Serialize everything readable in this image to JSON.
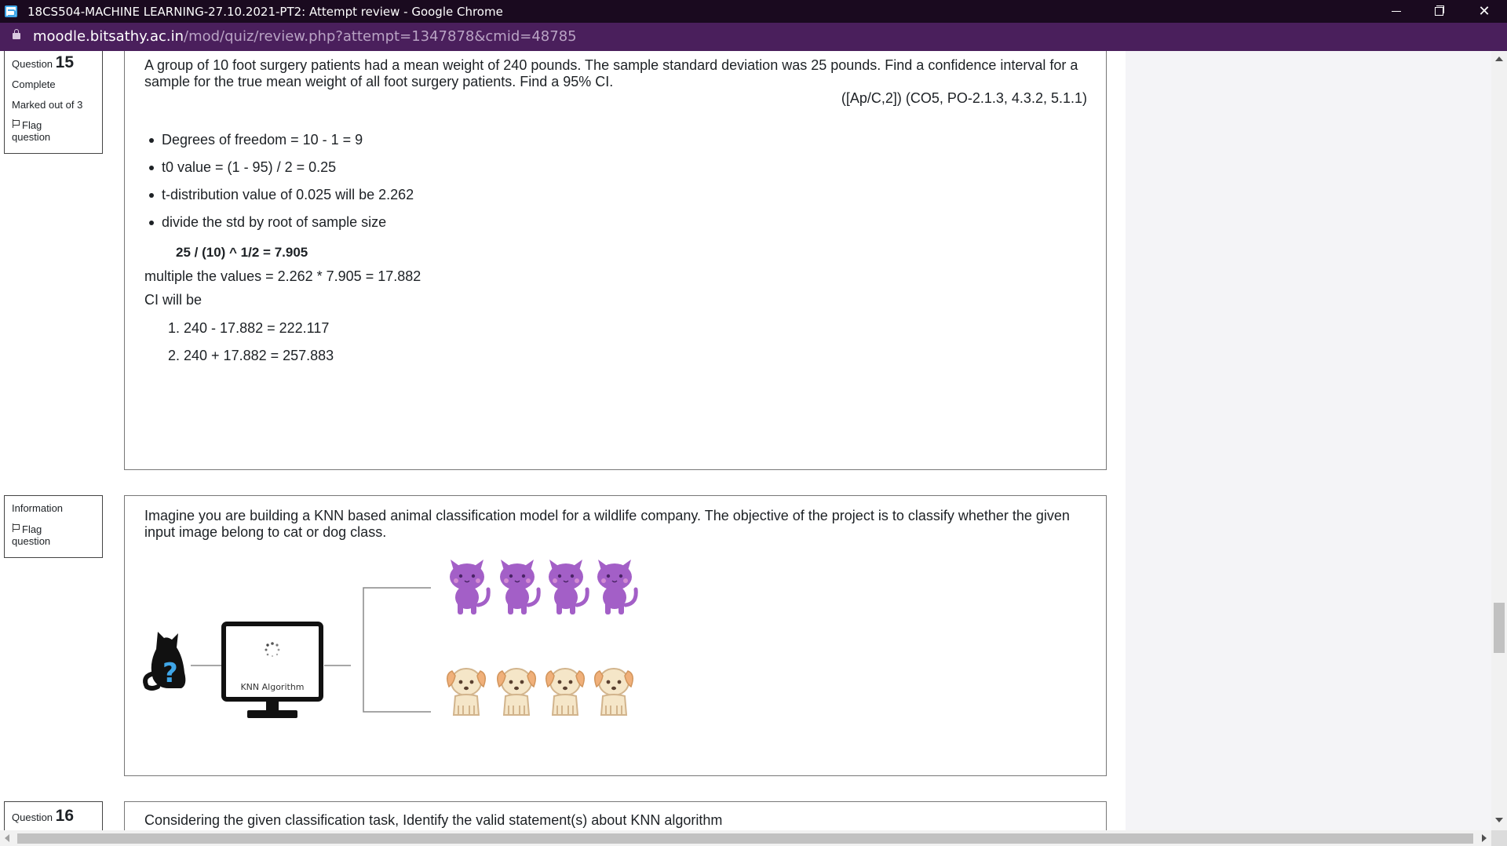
{
  "window": {
    "title": "18CS504-MACHINE LEARNING-27.10.2021-PT2: Attempt review - Google Chrome",
    "minimize_icon": "minimize-icon",
    "restore_icon": "restore-icon",
    "close_glyph": "✕"
  },
  "address_bar": {
    "host": "moodle.bitsathy.ac.in",
    "path": "/mod/quiz/review.php?attempt=1347878&cmid=48785"
  },
  "question15": {
    "label": "Question",
    "number": "15",
    "status": "Complete",
    "marks": "Marked out of 3",
    "flag_label": "Flag",
    "flag_label2": "question",
    "text": "A group of 10 foot surgery patients had a mean weight of 240 pounds. The sample standard deviation was 25 pounds. Find a confidence interval for a sample for the true mean weight of all foot surgery patients. Find a 95% CI.",
    "reference": "([Ap/C,2]) (CO5, PO-2.1.3, 4.3.2, 5.1.1)",
    "answer": {
      "bullets": [
        "Degrees of freedom = 10 - 1 = 9",
        "t0 value = (1 - 95) / 2 = 0.25",
        "t-distribution value of 0.025 will be 2.262",
        "divide the std by root of sample size"
      ],
      "formula": "25 / (10) ^ 1/2 = 7.905",
      "multiply": "multiple the values = 2.262 * 7.905 = 17.882",
      "ci_label": "CI will be",
      "ci_items": [
        "1. 240 - 17.882 = 222.117",
        "2. 240 + 17.882 = 257.883"
      ]
    }
  },
  "information": {
    "label": "Information",
    "flag_label": "Flag",
    "flag_label2": "question",
    "text": "Imagine you are building a KNN based animal classification model for a wildlife company. The objective of the project is to classify whether the given input image belong to cat or dog class.",
    "diagram": {
      "monitor_label": "KNN Algorithm",
      "unknown_mark": "?"
    }
  },
  "question16": {
    "label": "Question",
    "number": "16",
    "text": "Considering the given classification task, Identify the valid statement(s) about KNN algorithm"
  },
  "colors": {
    "titlebar": "#1a0a1f",
    "addressbar": "#4a1f5c",
    "cat": "#a35fc7",
    "dog": "#f3deb8"
  }
}
